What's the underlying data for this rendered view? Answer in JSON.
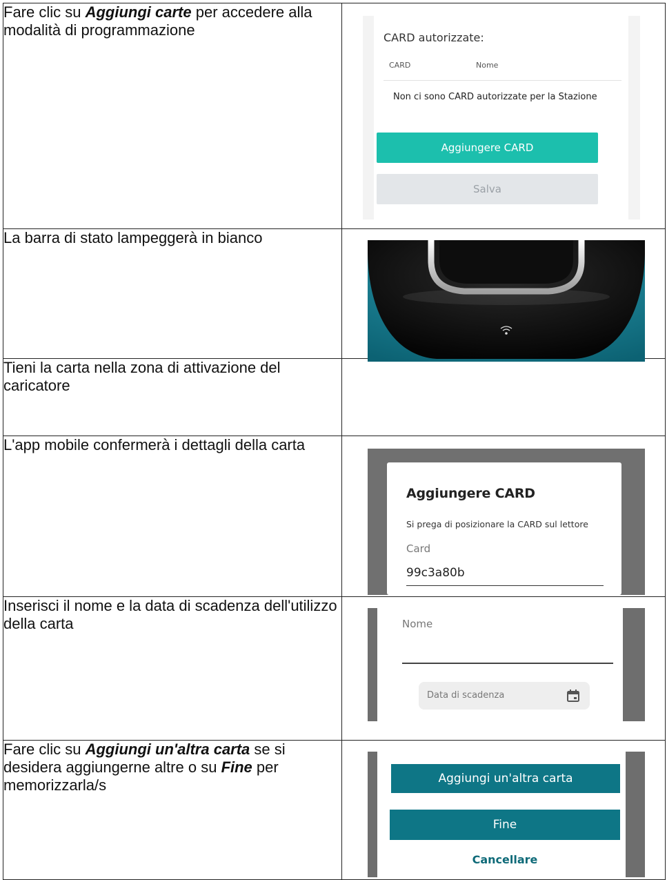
{
  "rows": [
    {
      "pre": "Fare clic su ",
      "bold": "Aggiungi carte",
      "post": " per accedere alla modalità di programmazione",
      "screen": {
        "heading": "CARD autorizzate:",
        "col_card": "CARD",
        "col_name": "Nome",
        "empty_msg": "Non ci sono CARD autorizzate per la Stazione",
        "add_button": "Aggiungere CARD",
        "save_button": "Salva"
      }
    },
    {
      "text": "La barra di stato lampeggerà in bianco"
    },
    {
      "text": "Tieni la carta nella zona di attivazione del caricatore"
    },
    {
      "text": "L'app mobile confermerà i dettagli della carta",
      "screen": {
        "title": "Aggiungere CARD",
        "message": "Si prega di posizionare la CARD sul lettore",
        "field_label": "Card",
        "field_value": "99c3a80b"
      }
    },
    {
      "text": "Inserisci il nome e la data di scadenza dell'utilizzo della carta",
      "screen": {
        "name_label": "Nome",
        "date_placeholder": "Data di scadenza",
        "calendar_icon": "calendar-icon"
      }
    },
    {
      "pre": "Fare clic su ",
      "bold1": "Aggiungi un'altra carta",
      "mid": " se si desidera aggiungerne altre o su ",
      "bold2": "Fine",
      "post": " per memorizzarla/s",
      "screen": {
        "add_another_button": "Aggiungi un'altra carta",
        "done_button": "Fine",
        "cancel_button": "Cancellare"
      }
    }
  ],
  "colors": {
    "teal_primary": "#1cbfad",
    "teal_dark": "#0e7686",
    "photo_background": "#127d91"
  }
}
